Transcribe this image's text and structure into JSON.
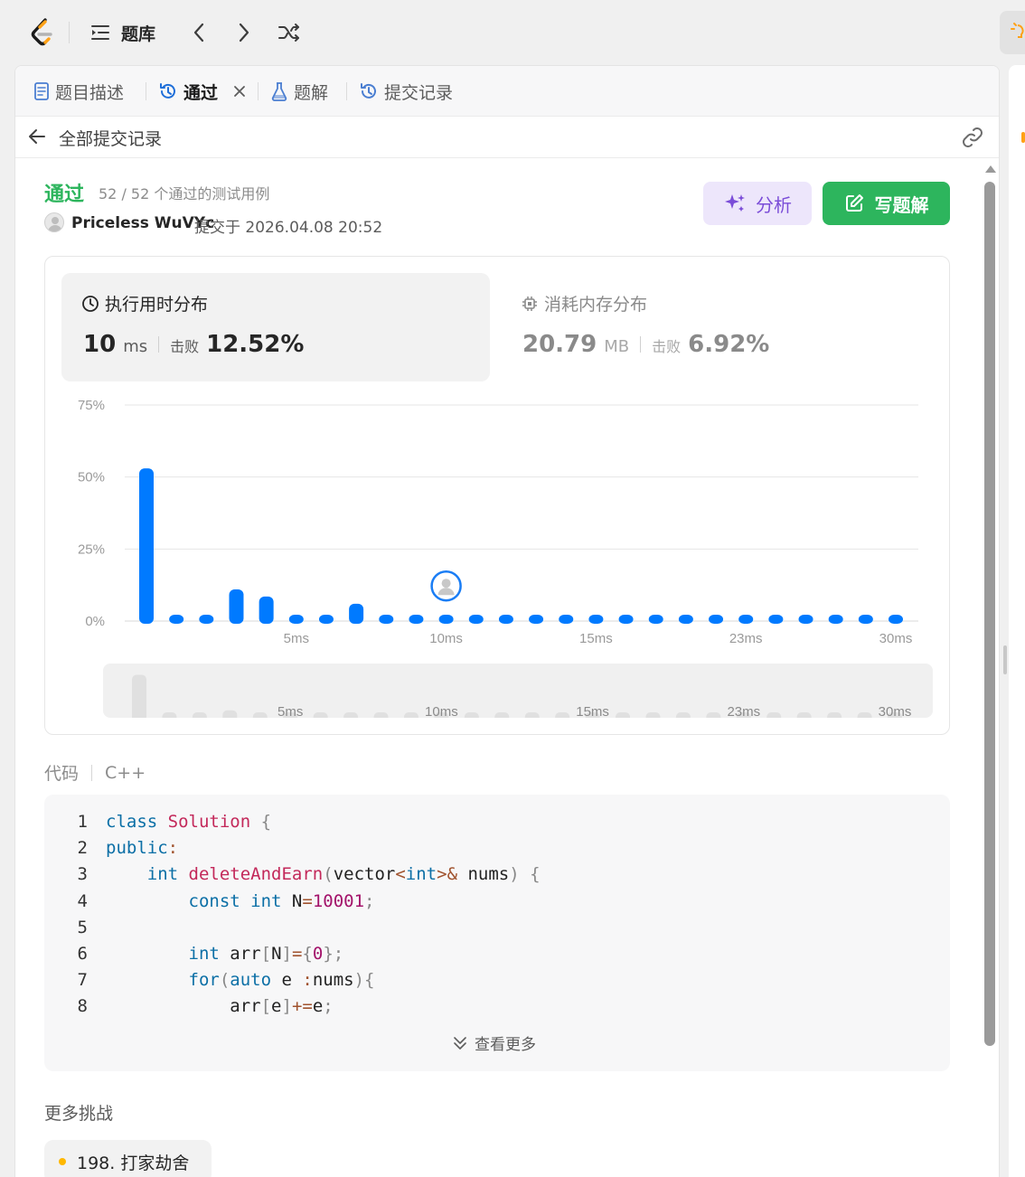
{
  "nav": {
    "problem_list_label": "题库",
    "icons": [
      "leetcode-logo",
      "list-icon",
      "chevron-left-icon",
      "chevron-right-icon",
      "shuffle-icon"
    ]
  },
  "tabs": [
    {
      "label": "题目描述",
      "icon": "description-icon",
      "active": false
    },
    {
      "label": "通过",
      "icon": "history-icon",
      "active": true,
      "closable": true
    },
    {
      "label": "题解",
      "icon": "flask-icon",
      "active": false
    },
    {
      "label": "提交记录",
      "icon": "history-icon",
      "active": false
    }
  ],
  "subbar": {
    "back_label": "全部提交记录"
  },
  "result": {
    "status": "通过",
    "testcases": "52 / 52 个通过的测试用例",
    "author": "Priceless WuVYc",
    "submitted": "提交于 2026.04.08 20:52",
    "analyze_label": "分析",
    "write_solution_label": "写题解"
  },
  "runtime": {
    "title": "执行用时分布",
    "value": "10",
    "unit": "ms",
    "beat_label": "击败",
    "beat_pct": "12.52%"
  },
  "memory": {
    "title": "消耗内存分布",
    "value": "20.79",
    "unit": "MB",
    "beat_label": "击败",
    "beat_pct": "6.92%"
  },
  "chart_data": {
    "type": "bar",
    "y_ticks": [
      "75%",
      "50%",
      "25%",
      "0%"
    ],
    "ylim": [
      0,
      75
    ],
    "x_tick_labels": [
      {
        "index": 5,
        "label": "5ms"
      },
      {
        "index": 10,
        "label": "10ms"
      },
      {
        "index": 15,
        "label": "15ms"
      },
      {
        "index": 20,
        "label": "23ms"
      },
      {
        "index": 25,
        "label": "30ms"
      }
    ],
    "values": [
      53,
      1.5,
      1.5,
      11,
      8.5,
      1.5,
      1.5,
      6,
      1.5,
      1.5,
      1.5,
      1.5,
      1.5,
      1.5,
      1.5,
      1.5,
      1.5,
      1.5,
      1.5,
      1.5,
      1.5,
      1.5,
      1.5,
      1.5,
      1.5,
      1.5
    ],
    "highlight_index": 10,
    "bar_color": "#007aff",
    "grid": true
  },
  "code": {
    "label": "代码",
    "language": "C++",
    "show_more_label": "查看更多",
    "lines": [
      [
        {
          "t": "kw",
          "s": "class "
        },
        {
          "t": "ty",
          "s": "Solution "
        },
        {
          "t": "pn",
          "s": "{"
        }
      ],
      [
        {
          "t": "kw",
          "s": "public"
        },
        {
          "t": "op",
          "s": ":"
        }
      ],
      [
        {
          "t": "tx",
          "s": "    "
        },
        {
          "t": "kw",
          "s": "int "
        },
        {
          "t": "fn",
          "s": "deleteAndEarn"
        },
        {
          "t": "pn",
          "s": "("
        },
        {
          "t": "tx",
          "s": "vector"
        },
        {
          "t": "op",
          "s": "<"
        },
        {
          "t": "kw",
          "s": "int"
        },
        {
          "t": "op",
          "s": ">&"
        },
        {
          "t": "tx",
          "s": " nums"
        },
        {
          "t": "pn",
          "s": ") {"
        }
      ],
      [
        {
          "t": "tx",
          "s": "        "
        },
        {
          "t": "kw",
          "s": "const int "
        },
        {
          "t": "tx",
          "s": "N"
        },
        {
          "t": "op",
          "s": "="
        },
        {
          "t": "nm",
          "s": "10001"
        },
        {
          "t": "pn",
          "s": ";"
        }
      ],
      [
        {
          "t": "tx",
          "s": ""
        }
      ],
      [
        {
          "t": "tx",
          "s": "        "
        },
        {
          "t": "kw",
          "s": "int "
        },
        {
          "t": "tx",
          "s": "arr"
        },
        {
          "t": "pn",
          "s": "["
        },
        {
          "t": "tx",
          "s": "N"
        },
        {
          "t": "pn",
          "s": "]"
        },
        {
          "t": "op",
          "s": "="
        },
        {
          "t": "pn",
          "s": "{"
        },
        {
          "t": "nm",
          "s": "0"
        },
        {
          "t": "pn",
          "s": "};"
        }
      ],
      [
        {
          "t": "tx",
          "s": "        "
        },
        {
          "t": "kw",
          "s": "for"
        },
        {
          "t": "pn",
          "s": "("
        },
        {
          "t": "kw",
          "s": "auto "
        },
        {
          "t": "tx",
          "s": "e "
        },
        {
          "t": "op",
          "s": ":"
        },
        {
          "t": "tx",
          "s": "nums"
        },
        {
          "t": "pn",
          "s": "){"
        }
      ],
      [
        {
          "t": "tx",
          "s": "            arr"
        },
        {
          "t": "pn",
          "s": "["
        },
        {
          "t": "tx",
          "s": "e"
        },
        {
          "t": "pn",
          "s": "]"
        },
        {
          "t": "op",
          "s": "+="
        },
        {
          "t": "tx",
          "s": "e"
        },
        {
          "t": "pn",
          "s": ";"
        }
      ]
    ]
  },
  "more": {
    "title": "更多挑战",
    "items": [
      {
        "label": "198. 打家劫舍",
        "dot_color": "#ffb800"
      }
    ]
  }
}
